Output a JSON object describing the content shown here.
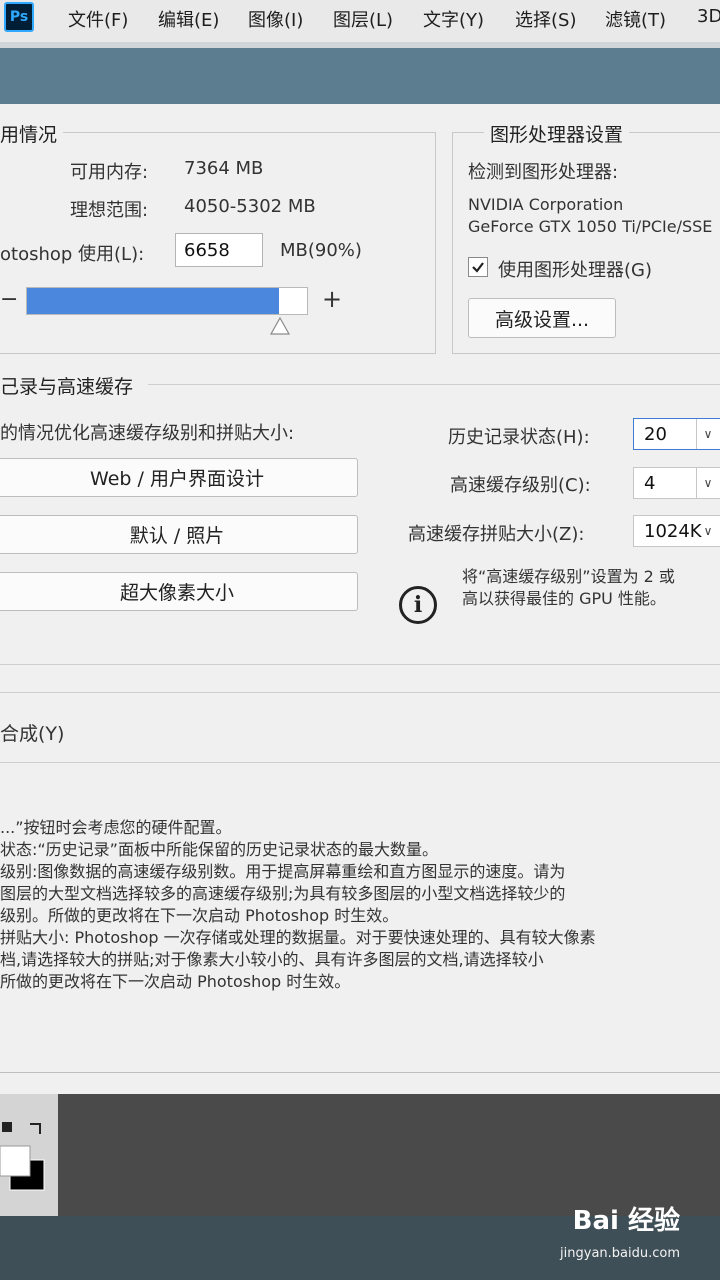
{
  "app": {
    "logo": "Ps"
  },
  "menubar": {
    "items": [
      "文件(F)",
      "编辑(E)",
      "图像(I)",
      "图层(L)",
      "文字(Y)",
      "选择(S)",
      "滤镜(T)",
      "3D"
    ]
  },
  "memory": {
    "title": "用情况",
    "available_label": "可用内存:",
    "available_value": "7364 MB",
    "ideal_label": "理想范围:",
    "ideal_value": "4050-5302 MB",
    "usage_label": "otoshop 使用(L):",
    "usage_value": "6658",
    "usage_unit": "MB(90%)",
    "minus": "−",
    "plus": "+",
    "slider_fraction": 0.9
  },
  "gpu": {
    "title": "图形处理器设置",
    "detected_label": "检测到图形处理器:",
    "vendor": "NVIDIA Corporation",
    "model": "GeForce GTX 1050 Ti/PCIe/SSE",
    "use_gpu_label": "使用图形处理器(G)",
    "use_gpu_checked": true,
    "advanced_button": "高级设置..."
  },
  "history": {
    "title": "己录与高速缓存",
    "optimize_label": "的情况优化高速缓存级别和拼贴大小:",
    "preset_buttons": [
      "Web / 用户界面设计",
      "默认 / 照片",
      "超大像素大小"
    ],
    "states_label": "历史记录状态(H):",
    "states_value": "20",
    "cache_levels_label": "高速缓存级别(C):",
    "cache_levels_value": "4",
    "tile_size_label": "高速缓存拼贴大小(Z):",
    "tile_size_value": "1024K",
    "info_line1": "将“高速缓存级别”设置为 2 或",
    "info_line2": "高以获得最佳的 GPU 性能。",
    "info_icon": "i"
  },
  "compose": {
    "label": "合成(Y)"
  },
  "description": {
    "lines": [
      "...”按钮时会考虑您的硬件配置。",
      "状态:“历史记录”面板中所能保留的历史记录状态的最大数量。",
      "级别:图像数据的高速缓存级别数。用于提高屏幕重绘和直方图显示的速度。请为",
      "图层的大型文档选择较多的高速缓存级别;为具有较多图层的小型文档选择较少的",
      "级别。所做的更改将在下一次启动 Photoshop 时生效。",
      "拼贴大小: Photoshop 一次存储或处理的数据量。对于要快速处理的、具有较大像素",
      "档,请选择较大的拼贴;对于像素大小较小的、具有许多图层的文档,请选择较小",
      "所做的更改将在下一次启动 Photoshop 时生效。"
    ]
  },
  "watermark": {
    "brand": "Bai  经验",
    "url": "jingyan.baidu.com"
  }
}
